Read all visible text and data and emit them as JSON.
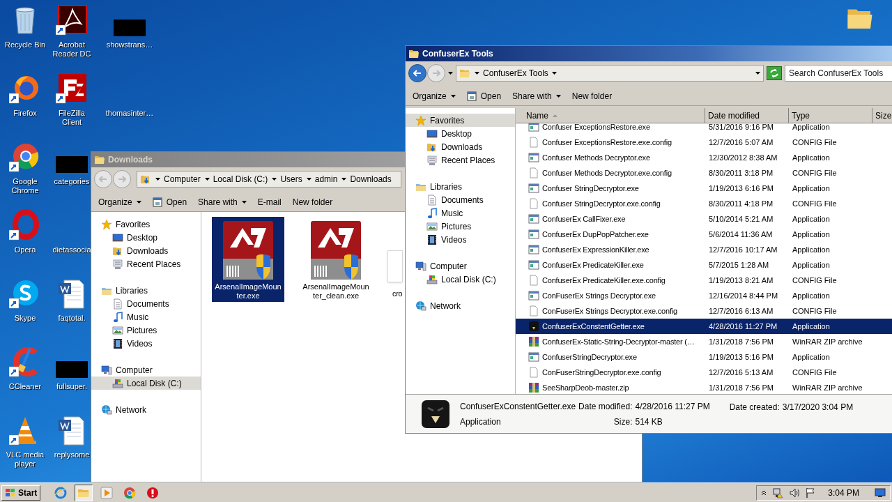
{
  "desktop_icons": [
    {
      "label": "Recycle Bin",
      "kind": "recycle"
    },
    {
      "label": "Firefox",
      "kind": "firefox"
    },
    {
      "label": "Google Chrome",
      "kind": "chrome"
    },
    {
      "label": "Opera",
      "kind": "opera"
    },
    {
      "label": "Skype",
      "kind": "skype"
    },
    {
      "label": "CCleaner",
      "kind": "ccleaner"
    },
    {
      "label": "VLC media player",
      "kind": "vlc"
    },
    {
      "label": "Acrobat Reader DC",
      "kind": "acrobat"
    },
    {
      "label": "FileZilla Client",
      "kind": "filezilla"
    },
    {
      "label": "categories",
      "kind": "redacted"
    },
    {
      "label": "dietassocia",
      "kind": "blank"
    },
    {
      "label": "faqtotal.",
      "kind": "word"
    },
    {
      "label": "fullsuper.",
      "kind": "redacted"
    },
    {
      "label": "replysome",
      "kind": "word"
    },
    {
      "label": "showstrans…",
      "kind": "redacted"
    },
    {
      "label": "thomasinter…",
      "kind": "blank"
    }
  ],
  "downloads_window": {
    "title": "Downloads",
    "active": false,
    "breadcrumb": [
      "Computer",
      "Local Disk (C:)",
      "Users",
      "admin",
      "Downloads"
    ],
    "toolbar": [
      {
        "label": "Organize",
        "kind": "menu"
      },
      {
        "label": "Open",
        "kind": "open"
      },
      {
        "label": "Share with",
        "kind": "menu"
      },
      {
        "label": "E-mail",
        "kind": "plain"
      },
      {
        "label": "New folder",
        "kind": "plain"
      }
    ],
    "nav": [
      {
        "label": "Favorites",
        "kind": "star",
        "selected": false,
        "children": [
          {
            "label": "Desktop",
            "kind": "desktop",
            "selected": false
          },
          {
            "label": "Downloads",
            "kind": "downloads",
            "selected": false
          },
          {
            "label": "Recent Places",
            "kind": "recent",
            "selected": false
          }
        ]
      },
      {
        "label": "Libraries",
        "kind": "library",
        "selected": false,
        "children": [
          {
            "label": "Documents",
            "kind": "documents",
            "selected": false
          },
          {
            "label": "Music",
            "kind": "music",
            "selected": false
          },
          {
            "label": "Pictures",
            "kind": "pictures",
            "selected": false
          },
          {
            "label": "Videos",
            "kind": "videos",
            "selected": false
          }
        ]
      },
      {
        "label": "Computer",
        "kind": "computer",
        "selected": false,
        "children": [
          {
            "label": "Local Disk (C:)",
            "kind": "disk",
            "selected": true
          }
        ]
      },
      {
        "label": "Network",
        "kind": "network",
        "selected": false
      }
    ],
    "items": [
      {
        "label": "ArsenalImageMounter.exe",
        "kind": "drive",
        "selected": true
      },
      {
        "label": "ArsenalImageMounter_clean.exe",
        "kind": "drive",
        "selected": false
      },
      {
        "label": "cro",
        "kind": "document",
        "selected": false
      }
    ]
  },
  "tools_window": {
    "title": "ConfuserEx Tools",
    "active": true,
    "breadcrumb": [
      "ConfuserEx Tools"
    ],
    "search_placeholder": "Search ConfuserEx Tools",
    "toolbar": [
      {
        "label": "Organize",
        "kind": "menu"
      },
      {
        "label": "Open",
        "kind": "open"
      },
      {
        "label": "Share with",
        "kind": "menu"
      },
      {
        "label": "New folder",
        "kind": "plain"
      }
    ],
    "nav": [
      {
        "label": "Favorites",
        "kind": "star",
        "selected": true,
        "children": [
          {
            "label": "Desktop",
            "kind": "desktop",
            "selected": false
          },
          {
            "label": "Downloads",
            "kind": "downloads",
            "selected": false
          },
          {
            "label": "Recent Places",
            "kind": "recent",
            "selected": false
          }
        ]
      },
      {
        "label": "Libraries",
        "kind": "library",
        "selected": false,
        "children": [
          {
            "label": "Documents",
            "kind": "documents",
            "selected": false
          },
          {
            "label": "Music",
            "kind": "music",
            "selected": false
          },
          {
            "label": "Pictures",
            "kind": "pictures",
            "selected": false
          },
          {
            "label": "Videos",
            "kind": "videos",
            "selected": false
          }
        ]
      },
      {
        "label": "Computer",
        "kind": "computer",
        "selected": false,
        "children": [
          {
            "label": "Local Disk (C:)",
            "kind": "disk",
            "selected": false
          }
        ]
      },
      {
        "label": "Network",
        "kind": "network",
        "selected": false
      }
    ],
    "columns": [
      "Name",
      "Date modified",
      "Type",
      "Size"
    ],
    "rows": [
      {
        "name": "Confuser ExceptionsRestore.exe",
        "date": "5/31/2016 9:16 PM",
        "type": "Application",
        "kind": "app",
        "selected": false
      },
      {
        "name": "Confuser ExceptionsRestore.exe.config",
        "date": "12/7/2016 5:07 AM",
        "type": "CONFIG File",
        "kind": "config",
        "selected": false
      },
      {
        "name": "Confuser Methods Decryptor.exe",
        "date": "12/30/2012 8:38 AM",
        "type": "Application",
        "kind": "app",
        "selected": false
      },
      {
        "name": "Confuser Methods Decryptor.exe.config",
        "date": "8/30/2011 3:18 PM",
        "type": "CONFIG File",
        "kind": "config",
        "selected": false
      },
      {
        "name": "Confuser StringDecryptor.exe",
        "date": "1/19/2013 6:16 PM",
        "type": "Application",
        "kind": "app",
        "selected": false
      },
      {
        "name": "Confuser StringDecryptor.exe.config",
        "date": "8/30/2011 4:18 PM",
        "type": "CONFIG File",
        "kind": "config",
        "selected": false
      },
      {
        "name": "ConfuserEx CallFixer.exe",
        "date": "5/10/2014 5:21 AM",
        "type": "Application",
        "kind": "app",
        "selected": false
      },
      {
        "name": "ConfuserEx DupPopPatcher.exe",
        "date": "5/6/2014 11:36 AM",
        "type": "Application",
        "kind": "app",
        "selected": false
      },
      {
        "name": "ConfuserEx ExpressionKiller.exe",
        "date": "12/7/2016 10:17 AM",
        "type": "Application",
        "kind": "app",
        "selected": false
      },
      {
        "name": "ConfuserEx PredicateKiller.exe",
        "date": "5/7/2015 1:28 AM",
        "type": "Application",
        "kind": "app",
        "selected": false
      },
      {
        "name": "ConfuserEx PredicateKiller.exe.config",
        "date": "1/19/2013 8:21 AM",
        "type": "CONFIG File",
        "kind": "config",
        "selected": false
      },
      {
        "name": "ConFuserEx Strings Decryptor.exe",
        "date": "12/16/2014 8:44 PM",
        "type": "Application",
        "kind": "app",
        "selected": false
      },
      {
        "name": "ConFuserEx Strings Decryptor.exe.config",
        "date": "12/7/2016 6:13 AM",
        "type": "CONFIG File",
        "kind": "config",
        "selected": false
      },
      {
        "name": "ConfuserExConstentGetter.exe",
        "date": "4/28/2016 11:27 PM",
        "type": "Application",
        "kind": "bird",
        "selected": true
      },
      {
        "name": "ConfuserEx-Static-String-Decryptor-master (…",
        "date": "1/31/2018 7:56 PM",
        "type": "WinRAR ZIP archive",
        "kind": "zip",
        "selected": false
      },
      {
        "name": "ConfuserStringDecryptor.exe",
        "date": "1/19/2013 5:16 PM",
        "type": "Application",
        "kind": "app",
        "selected": false
      },
      {
        "name": "ConFuserStringDecryptor.exe.config",
        "date": "12/7/2016 5:13 AM",
        "type": "CONFIG File",
        "kind": "config",
        "selected": false
      },
      {
        "name": "SeeSharpDeob-master.zip",
        "date": "1/31/2018 7:56 PM",
        "type": "WinRAR ZIP archive",
        "kind": "zip",
        "selected": false
      }
    ],
    "details": {
      "name": "ConfuserExConstentGetter.exe",
      "type": "Application",
      "modified_label": "Date modified:",
      "modified": "4/28/2016 11:27 PM",
      "created_label": "Date created:",
      "created": "3/17/2020 3:04 PM",
      "size_label": "Size:",
      "size": "514 KB"
    }
  },
  "taskbar": {
    "start": "Start",
    "apps": [
      {
        "kind": "ie",
        "active": false
      },
      {
        "kind": "explorer",
        "active": true
      },
      {
        "kind": "media",
        "active": false
      },
      {
        "kind": "chrome",
        "active": false
      },
      {
        "kind": "opera",
        "active": false
      }
    ],
    "time": "3:04 PM"
  }
}
